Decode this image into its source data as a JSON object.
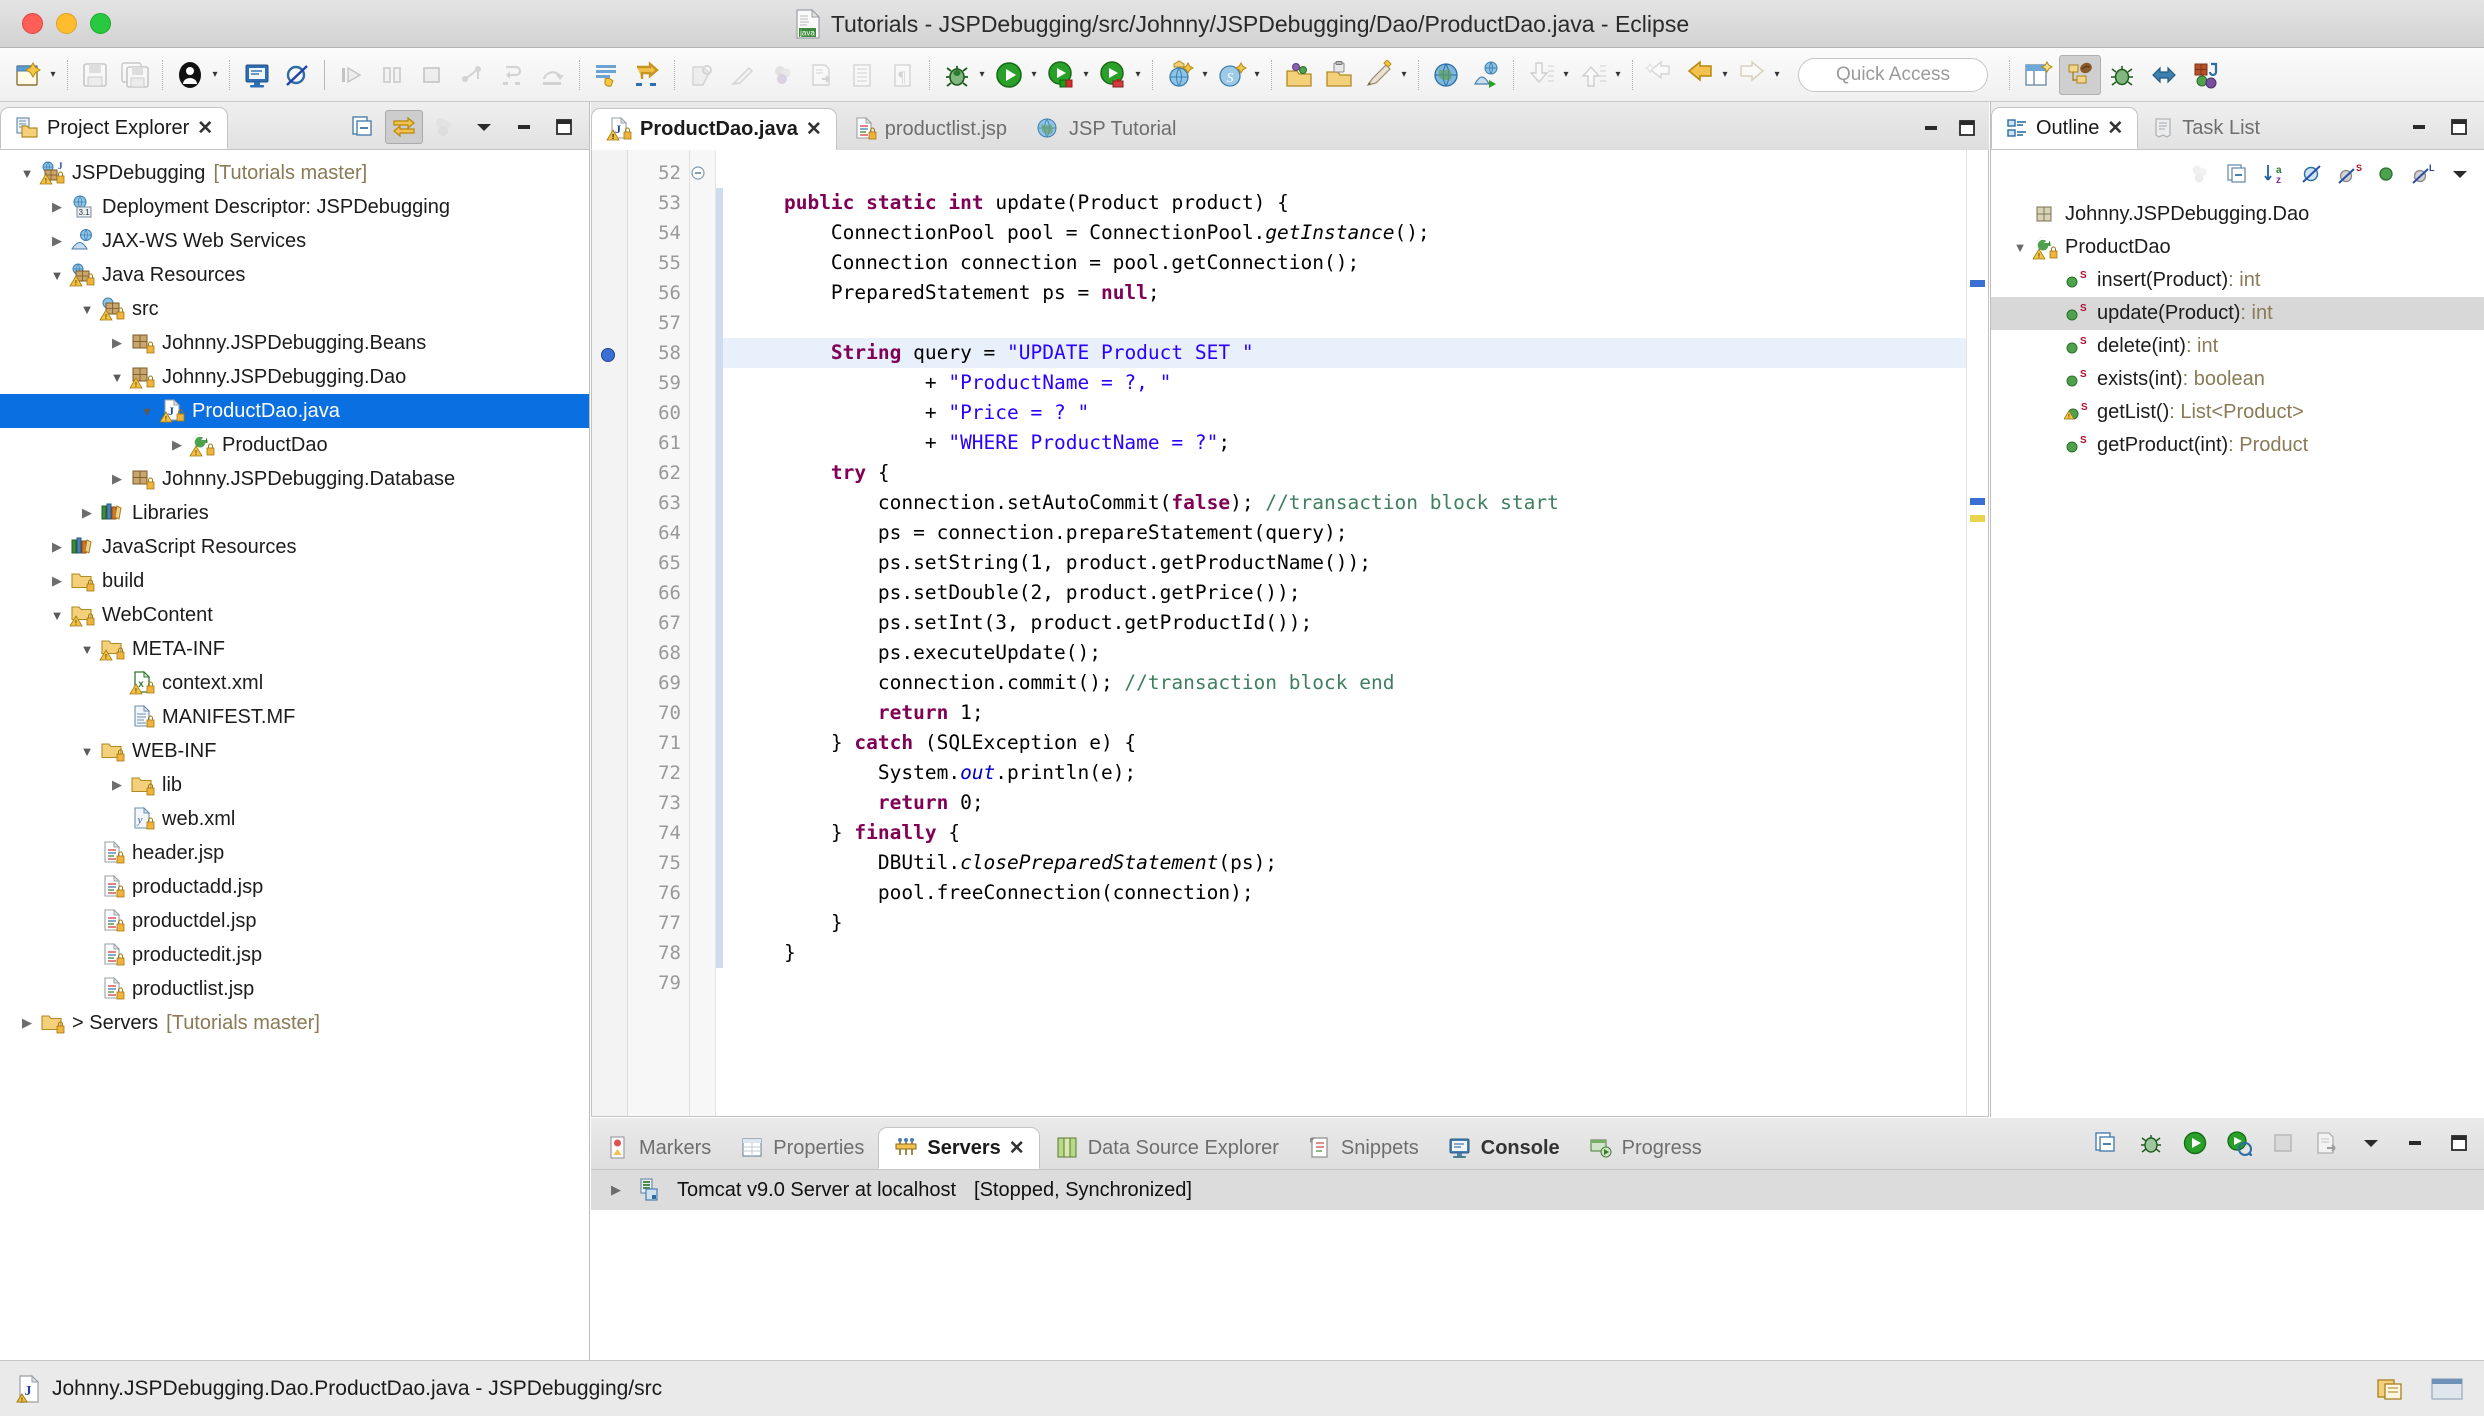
{
  "window": {
    "title": "Tutorials - JSPDebugging/src/Johnny/JSPDebugging/Dao/ProductDao.java - Eclipse",
    "traffic_lights": [
      "close",
      "minimize",
      "zoom"
    ]
  },
  "toolbar": {
    "quick_access_placeholder": "Quick Access",
    "buttons": [
      {
        "name": "new-wizard",
        "label": "New",
        "enabled": true,
        "dropdown": true
      },
      {
        "name": "save",
        "label": "Save",
        "enabled": false
      },
      {
        "name": "save-all",
        "label": "Save All",
        "enabled": false
      },
      {
        "name": "user-profile",
        "label": "User",
        "enabled": true,
        "dropdown": true
      },
      {
        "name": "new-jsp-file",
        "label": "New JSP File",
        "enabled": true
      },
      {
        "name": "toggle-breakpoint-skip",
        "label": "Skip All Breakpoints",
        "enabled": true
      },
      {
        "name": "resume",
        "label": "Resume",
        "enabled": false
      },
      {
        "name": "suspend",
        "label": "Suspend",
        "enabled": false
      },
      {
        "name": "terminate",
        "label": "Terminate",
        "enabled": false
      },
      {
        "name": "disconnect",
        "label": "Disconnect",
        "enabled": false
      },
      {
        "name": "step-into",
        "label": "Step Into",
        "enabled": false
      },
      {
        "name": "step-over",
        "label": "Step Over",
        "enabled": false
      },
      {
        "name": "step-return",
        "label": "Step Return",
        "enabled": false
      },
      {
        "name": "drop-to-frame",
        "label": "Drop to Frame",
        "enabled": false
      },
      {
        "name": "next-annotation",
        "label": "Next Annotation",
        "enabled": true
      },
      {
        "name": "previous-annotation",
        "label": "Previous Annotation",
        "enabled": true
      },
      {
        "name": "open-type",
        "label": "Open Type",
        "enabled": false
      },
      {
        "name": "marker",
        "label": "Marker",
        "enabled": false
      },
      {
        "name": "search",
        "label": "Search",
        "enabled": false
      },
      {
        "name": "publish",
        "label": "Publish",
        "enabled": false
      },
      {
        "name": "toggle-block-selection",
        "label": "Toggle Block Selection",
        "enabled": false
      },
      {
        "name": "show-whitespace",
        "label": "Show Whitespace Characters",
        "enabled": false
      },
      {
        "name": "debug",
        "label": "Debug",
        "enabled": true,
        "dropdown": true
      },
      {
        "name": "run",
        "label": "Run",
        "enabled": true,
        "dropdown": true
      },
      {
        "name": "run-as-server",
        "label": "Run As Server",
        "enabled": true,
        "dropdown": true
      },
      {
        "name": "coverage",
        "label": "Coverage",
        "enabled": true,
        "dropdown": true
      },
      {
        "name": "run-last-tool",
        "label": "Run Last Tool",
        "enabled": true,
        "dropdown": true
      },
      {
        "name": "new-web-service",
        "label": "New Web Service",
        "enabled": true,
        "dropdown": true
      },
      {
        "name": "new-web-project",
        "label": "New Dynamic Web Project",
        "enabled": true,
        "dropdown": true
      },
      {
        "name": "open-task",
        "label": "Open Task",
        "enabled": true
      },
      {
        "name": "new-task",
        "label": "New Task",
        "enabled": true
      },
      {
        "name": "activate-task",
        "label": "Activate Task",
        "enabled": true,
        "dropdown": true
      },
      {
        "name": "open-web-browser",
        "label": "Open Web Browser",
        "enabled": true
      },
      {
        "name": "launch-web-services-explorer",
        "label": "Web Services Explorer",
        "enabled": true
      },
      {
        "name": "import-task",
        "label": "Import",
        "enabled": false,
        "dropdown": true
      },
      {
        "name": "export-task",
        "label": "Export",
        "enabled": false,
        "dropdown": true
      },
      {
        "name": "back",
        "label": "Back",
        "enabled": false,
        "dropdown": false
      },
      {
        "name": "previous-edit",
        "label": "Previous Edit Location",
        "enabled": true,
        "dropdown": true
      },
      {
        "name": "forward",
        "label": "Forward",
        "enabled": false,
        "dropdown": true
      }
    ],
    "perspectives": [
      {
        "name": "open-perspective",
        "label": "Open Perspective",
        "active": false
      },
      {
        "name": "perspective-java-ee",
        "label": "Java EE",
        "active": true
      },
      {
        "name": "perspective-debug",
        "label": "Debug",
        "active": false
      },
      {
        "name": "perspective-web",
        "label": "Web",
        "active": false
      },
      {
        "name": "perspective-java",
        "label": "Java",
        "active": false
      }
    ]
  },
  "project_explorer": {
    "tab_label": "Project Explorer",
    "toolbar": [
      {
        "name": "collapse-all",
        "label": "Collapse All",
        "pressed": false
      },
      {
        "name": "link-with-editor",
        "label": "Link with Editor",
        "pressed": true
      },
      {
        "name": "focus-on-active-task",
        "label": "Focus on Active Task",
        "pressed": false
      },
      {
        "name": "view-menu",
        "label": "View Menu",
        "pressed": false
      },
      {
        "name": "minimize",
        "label": "Minimize",
        "pressed": false
      },
      {
        "name": "maximize",
        "label": "Maximize",
        "pressed": false
      }
    ],
    "tree": [
      {
        "label": "JSPDebugging",
        "suffix": "[Tutorials master]",
        "indent": 0,
        "twist": "open",
        "icon": "project-warning-icon",
        "selected": false
      },
      {
        "label": "Deployment Descriptor: JSPDebugging",
        "suffix": "",
        "indent": 1,
        "twist": "closed",
        "icon": "deployment-descriptor-icon",
        "selected": false
      },
      {
        "label": "JAX-WS Web Services",
        "suffix": "",
        "indent": 1,
        "twist": "closed",
        "icon": "jaxws-icon",
        "selected": false
      },
      {
        "label": "Java Resources",
        "suffix": "",
        "indent": 1,
        "twist": "open",
        "icon": "java-resources-icon",
        "selected": false
      },
      {
        "label": "src",
        "suffix": "",
        "indent": 2,
        "twist": "open",
        "icon": "source-folder-icon",
        "selected": false
      },
      {
        "label": "Johnny.JSPDebugging.Beans",
        "suffix": "",
        "indent": 3,
        "twist": "closed",
        "icon": "package-icon",
        "selected": false
      },
      {
        "label": "Johnny.JSPDebugging.Dao",
        "suffix": "",
        "indent": 3,
        "twist": "open",
        "icon": "package-warning-icon",
        "selected": false
      },
      {
        "label": "ProductDao.java",
        "suffix": "",
        "indent": 4,
        "twist": "open",
        "icon": "java-file-warning-icon",
        "selected": true
      },
      {
        "label": "ProductDao",
        "suffix": "",
        "indent": 5,
        "twist": "closed",
        "icon": "class-warning-icon",
        "selected": false
      },
      {
        "label": "Johnny.JSPDebugging.Database",
        "suffix": "",
        "indent": 3,
        "twist": "closed",
        "icon": "package-icon",
        "selected": false
      },
      {
        "label": "Libraries",
        "suffix": "",
        "indent": 2,
        "twist": "closed",
        "icon": "library-icon",
        "selected": false
      },
      {
        "label": "JavaScript Resources",
        "suffix": "",
        "indent": 1,
        "twist": "closed",
        "icon": "library-icon",
        "selected": false
      },
      {
        "label": "build",
        "suffix": "",
        "indent": 1,
        "twist": "closed",
        "icon": "folder-icon",
        "selected": false
      },
      {
        "label": "WebContent",
        "suffix": "",
        "indent": 1,
        "twist": "open",
        "icon": "folder-warning-icon",
        "selected": false
      },
      {
        "label": "META-INF",
        "suffix": "",
        "indent": 2,
        "twist": "open",
        "icon": "folder-warning-icon",
        "selected": false
      },
      {
        "label": "context.xml",
        "suffix": "",
        "indent": 3,
        "twist": "none",
        "icon": "xml-warning-icon",
        "selected": false
      },
      {
        "label": "MANIFEST.MF",
        "suffix": "",
        "indent": 3,
        "twist": "none",
        "icon": "manifest-icon",
        "selected": false
      },
      {
        "label": "WEB-INF",
        "suffix": "",
        "indent": 2,
        "twist": "open",
        "icon": "folder-icon",
        "selected": false
      },
      {
        "label": "lib",
        "suffix": "",
        "indent": 3,
        "twist": "closed",
        "icon": "folder-icon",
        "selected": false
      },
      {
        "label": "web.xml",
        "suffix": "",
        "indent": 3,
        "twist": "none",
        "icon": "webxml-icon",
        "selected": false
      },
      {
        "label": "header.jsp",
        "suffix": "",
        "indent": 2,
        "twist": "none",
        "icon": "jsp-icon",
        "selected": false
      },
      {
        "label": "productadd.jsp",
        "suffix": "",
        "indent": 2,
        "twist": "none",
        "icon": "jsp-icon",
        "selected": false
      },
      {
        "label": "productdel.jsp",
        "suffix": "",
        "indent": 2,
        "twist": "none",
        "icon": "jsp-icon",
        "selected": false
      },
      {
        "label": "productedit.jsp",
        "suffix": "",
        "indent": 2,
        "twist": "none",
        "icon": "jsp-icon",
        "selected": false
      },
      {
        "label": "productlist.jsp",
        "suffix": "",
        "indent": 2,
        "twist": "none",
        "icon": "jsp-icon",
        "selected": false
      },
      {
        "label": "> Servers",
        "suffix": "[Tutorials master]",
        "indent": 0,
        "twist": "closed",
        "icon": "folder-icon",
        "selected": false
      }
    ]
  },
  "editor": {
    "tabs": [
      {
        "label": "ProductDao.java",
        "icon": "java-file-warning-icon",
        "active": true,
        "closable": true
      },
      {
        "label": "productlist.jsp",
        "icon": "jsp-icon",
        "active": false,
        "closable": false
      },
      {
        "label": "JSP Tutorial",
        "icon": "globe-icon",
        "active": false,
        "closable": false
      }
    ],
    "controls": [
      {
        "name": "minimize",
        "label": "Minimize"
      },
      {
        "name": "maximize",
        "label": "Maximize"
      }
    ],
    "first_line_number": 52,
    "highlighted_line": 58,
    "breakpoint_line": 58,
    "folding_line": 53,
    "lines": [
      {
        "n": 52,
        "text": ""
      },
      {
        "n": 53,
        "text": "    public static int update(Product product) {"
      },
      {
        "n": 54,
        "text": "        ConnectionPool pool = ConnectionPool.getInstance();"
      },
      {
        "n": 55,
        "text": "        Connection connection = pool.getConnection();"
      },
      {
        "n": 56,
        "text": "        PreparedStatement ps = null;"
      },
      {
        "n": 57,
        "text": ""
      },
      {
        "n": 58,
        "text": "        String query = \"UPDATE Product SET \""
      },
      {
        "n": 59,
        "text": "                + \"ProductName = ?, \""
      },
      {
        "n": 60,
        "text": "                + \"Price = ? \""
      },
      {
        "n": 61,
        "text": "                + \"WHERE ProductName = ?\";"
      },
      {
        "n": 62,
        "text": "        try {"
      },
      {
        "n": 63,
        "text": "            connection.setAutoCommit(false); //transaction block start"
      },
      {
        "n": 64,
        "text": "            ps = connection.prepareStatement(query);"
      },
      {
        "n": 65,
        "text": "            ps.setString(1, product.getProductName());"
      },
      {
        "n": 66,
        "text": "            ps.setDouble(2, product.getPrice());"
      },
      {
        "n": 67,
        "text": "            ps.setInt(3, product.getProductId());"
      },
      {
        "n": 68,
        "text": "            ps.executeUpdate();"
      },
      {
        "n": 69,
        "text": "            connection.commit(); //transaction block end"
      },
      {
        "n": 70,
        "text": "            return 1;"
      },
      {
        "n": 71,
        "text": "        } catch (SQLException e) {"
      },
      {
        "n": 72,
        "text": "            System.out.println(e);"
      },
      {
        "n": 73,
        "text": "            return 0;"
      },
      {
        "n": 74,
        "text": "        } finally {"
      },
      {
        "n": 75,
        "text": "            DBUtil.closePreparedStatement(ps);"
      },
      {
        "n": 76,
        "text": "            pool.freeConnection(connection);"
      },
      {
        "n": 77,
        "text": "        }"
      },
      {
        "n": 78,
        "text": "    }"
      },
      {
        "n": 79,
        "text": ""
      }
    ]
  },
  "outline": {
    "tabs": [
      {
        "label": "Outline",
        "icon": "outline-icon",
        "active": true,
        "closable": true
      },
      {
        "label": "Task List",
        "icon": "tasklist-icon",
        "active": false,
        "closable": false
      }
    ],
    "controls": [
      {
        "name": "minimize",
        "label": "Minimize"
      },
      {
        "name": "maximize",
        "label": "Maximize"
      }
    ],
    "toolbar": [
      {
        "name": "focus-active-task",
        "label": "Focus on Active Task"
      },
      {
        "name": "collapse-all",
        "label": "Collapse All"
      },
      {
        "name": "sort",
        "label": "Sort"
      },
      {
        "name": "hide-fields",
        "label": "Hide Fields"
      },
      {
        "name": "hide-static",
        "label": "Hide Static Fields and Methods"
      },
      {
        "name": "hide-non-public",
        "label": "Hide Non-Public Members"
      },
      {
        "name": "hide-local-types",
        "label": "Hide Local Types"
      },
      {
        "name": "view-menu",
        "label": "View Menu"
      }
    ],
    "tree": [
      {
        "label": "Johnny.JSPDebugging.Dao",
        "type": "",
        "indent": 0,
        "twist": "none",
        "icon": "package-icon",
        "selected": false
      },
      {
        "label": "ProductDao",
        "type": "",
        "indent": 0,
        "twist": "open",
        "icon": "class-warning-icon",
        "selected": false
      },
      {
        "label": "insert(Product)",
        "type": " : int",
        "indent": 1,
        "twist": "none",
        "icon": "method-static-icon",
        "selected": false
      },
      {
        "label": "update(Product)",
        "type": " : int",
        "indent": 1,
        "twist": "none",
        "icon": "method-static-icon",
        "selected": true
      },
      {
        "label": "delete(int)",
        "type": " : int",
        "indent": 1,
        "twist": "none",
        "icon": "method-static-icon",
        "selected": false
      },
      {
        "label": "exists(int)",
        "type": " : boolean",
        "indent": 1,
        "twist": "none",
        "icon": "method-static-icon",
        "selected": false
      },
      {
        "label": "getList()",
        "type": " : List<Product>",
        "indent": 1,
        "twist": "none",
        "icon": "method-static-warning-icon",
        "selected": false
      },
      {
        "label": "getProduct(int)",
        "type": " : Product",
        "indent": 1,
        "twist": "none",
        "icon": "method-static-icon",
        "selected": false
      }
    ]
  },
  "bottom_panel": {
    "tabs": [
      {
        "label": "Markers",
        "icon": "markers-icon",
        "active": false,
        "closable": false
      },
      {
        "label": "Properties",
        "icon": "properties-icon",
        "active": false,
        "closable": false
      },
      {
        "label": "Servers",
        "icon": "servers-icon",
        "active": true,
        "closable": true
      },
      {
        "label": "Data Source Explorer",
        "icon": "datasource-icon",
        "active": false,
        "closable": false
      },
      {
        "label": "Snippets",
        "icon": "snippets-icon",
        "active": false,
        "closable": false
      },
      {
        "label": "Console",
        "icon": "console-icon",
        "active": false,
        "closable": false,
        "bold": true
      },
      {
        "label": "Progress",
        "icon": "progress-icon",
        "active": false,
        "closable": false
      }
    ],
    "controls": [
      {
        "name": "collapse-all",
        "label": "Collapse All"
      },
      {
        "name": "debug-server",
        "label": "Start the server in debug mode"
      },
      {
        "name": "start-server",
        "label": "Start the server"
      },
      {
        "name": "profile-server",
        "label": "Start the server in profiling mode"
      },
      {
        "name": "stop-server",
        "label": "Stop the server"
      },
      {
        "name": "publish-server",
        "label": "Publish to the server"
      },
      {
        "name": "view-menu",
        "label": "View Menu"
      },
      {
        "name": "minimize",
        "label": "Minimize"
      },
      {
        "name": "maximize",
        "label": "Maximize"
      }
    ],
    "servers": [
      {
        "name": "Tomcat v9.0 Server at localhost",
        "status": "[Stopped, Synchronized]",
        "twist": "closed"
      }
    ]
  },
  "status_bar": {
    "text": "Johnny.JSPDebugging.Dao.ProductDao.java - JSPDebugging/src",
    "icon": "java-file-warning-icon",
    "right_icons": [
      "smartinsert-icon",
      "writable-indicator"
    ]
  },
  "colors": {
    "selection_blue": "#0a6fe0",
    "highlight_line": "#e8f0fb",
    "keyword": "#7f0055",
    "string": "#2a00ff",
    "comment": "#3f7f5f",
    "field": "#0000c0",
    "type_gray": "#8a7a55"
  }
}
